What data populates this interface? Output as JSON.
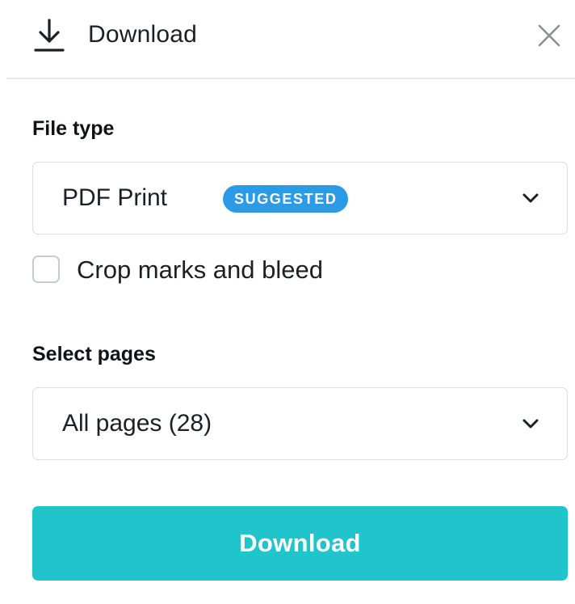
{
  "header": {
    "title": "Download",
    "icon": "download-icon",
    "close_icon": "close-icon"
  },
  "file_type": {
    "label": "File type",
    "selected": "PDF Print",
    "badge": "SUGGESTED",
    "icon": "chevron-down-icon"
  },
  "crop_marks": {
    "label": "Crop marks and bleed",
    "checked": false
  },
  "select_pages": {
    "label": "Select pages",
    "selected": "All pages (28)",
    "icon": "chevron-down-icon"
  },
  "actions": {
    "download_label": "Download"
  },
  "colors": {
    "accent": "#20c4cb",
    "badge": "#2b9be8",
    "border": "#dadce0"
  }
}
